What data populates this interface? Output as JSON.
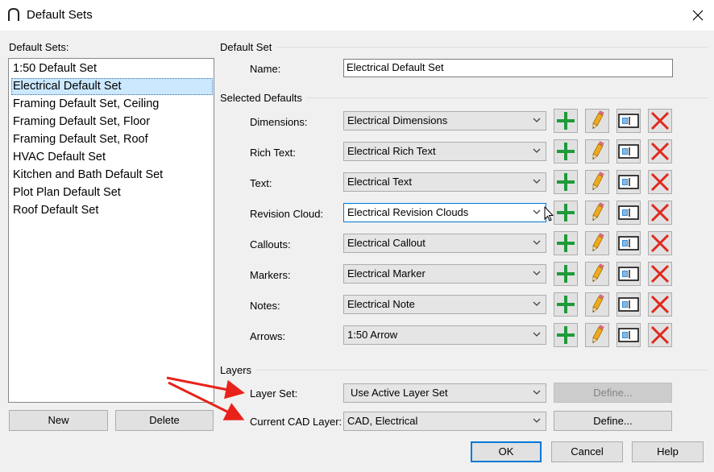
{
  "window": {
    "title": "Default Sets",
    "app_icon": "chief-architect-arc-icon",
    "close_icon": "close-icon"
  },
  "left": {
    "label": "Default Sets:",
    "items": [
      "1:50 Default Set",
      "Electrical Default Set",
      "Framing Default Set, Ceiling",
      "Framing Default Set, Floor",
      "Framing Default Set, Roof",
      "HVAC Default Set",
      "Kitchen and Bath Default Set",
      "Plot Plan Default Set",
      "Roof Default Set"
    ],
    "selected_index": 1,
    "new_label": "New",
    "delete_label": "Delete"
  },
  "default_set": {
    "heading": "Default Set",
    "name_label": "Name:",
    "name_value": "Electrical Default Set"
  },
  "selected_defaults": {
    "heading": "Selected Defaults",
    "rows": [
      {
        "label": "Dimensions:",
        "value": "Electrical Dimensions"
      },
      {
        "label": "Rich Text:",
        "value": "Electrical Rich Text"
      },
      {
        "label": "Text:",
        "value": "Electrical Text"
      },
      {
        "label": "Revision Cloud:",
        "value": "Electrical Revision Clouds"
      },
      {
        "label": "Callouts:",
        "value": "Electrical Callout"
      },
      {
        "label": "Markers:",
        "value": "Electrical Marker"
      },
      {
        "label": "Notes:",
        "value": "Electrical Note"
      },
      {
        "label": "Arrows:",
        "value": "1:50 Arrow"
      }
    ],
    "focused_row": 3,
    "row_icons": [
      "add-plus-icon",
      "edit-pencil-icon",
      "copy-icon",
      "delete-x-icon"
    ],
    "colors": {
      "plus": "#1f9a3a",
      "delete": "#e0281e",
      "pencil": "#f0a91c"
    }
  },
  "layers": {
    "heading": "Layers",
    "layer_set_label": "Layer Set:",
    "layer_set_value": "Use Active Layer Set",
    "layer_set_define": "Define...",
    "cad_layer_label": "Current CAD Layer:",
    "cad_layer_value": "CAD, Electrical",
    "cad_layer_define": "Define..."
  },
  "footer": {
    "ok": "OK",
    "cancel": "Cancel",
    "help": "Help"
  },
  "annotation_arrow_color": "#e8221a"
}
